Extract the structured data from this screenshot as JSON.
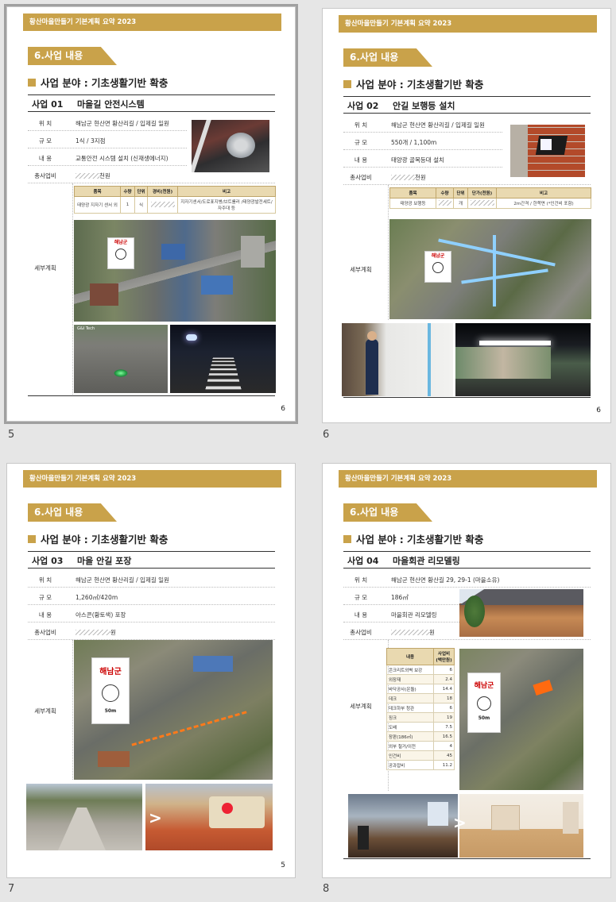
{
  "header_text": "황산마을만들기 기본계획 요약  2023",
  "section_tag": "6.사업 내용",
  "field_title": "사업 분야 : 기초생활기반 확충",
  "labels": {
    "location": "위  치",
    "scale": "규  모",
    "content": "내  용",
    "budget": "총사업비",
    "detail": "세부계획"
  },
  "slides": [
    {
      "thumb_number": "5",
      "page_number": "6",
      "code": "사업 01",
      "title": "마을길 안전시스템",
      "location": "해남군 현산면 황산리길 / 입제길 일원",
      "scale": "1식 / 3지점",
      "content": "교통안전 시스템 설치 (신재생에너지)",
      "budget": "천원",
      "table": {
        "headers": [
          "품목",
          "수량",
          "단위",
          "경비(천원)",
          "비고"
        ],
        "row": [
          "태양광 지자기 센서 외",
          "1",
          "식",
          "",
          "지자기센서/도로표지병/브트롤러 /태양광발전세트/자주대 등"
        ]
      },
      "map_logo": "해남군",
      "photo_caption": "G&I Tech"
    },
    {
      "thumb_number": "6",
      "page_number": "6",
      "code": "사업 02",
      "title": "안길 보행등 설치",
      "location": "해남군 현산면 황산리길 / 입제길 일원",
      "scale": "550개 / 1,100m",
      "content": "태양광 골목등대 설치",
      "budget": "천원",
      "table": {
        "headers": [
          "품목",
          "수량",
          "단위",
          "단가(천원)",
          "비고"
        ],
        "row": [
          "태양광 보행등",
          "",
          "개",
          "",
          "2m간격 / 한쪽면 (*인건비 포함)"
        ]
      },
      "map_logo": "해남군"
    },
    {
      "thumb_number": "7",
      "page_number": "5",
      "code": "사업 03",
      "title": "마을 안길 포장",
      "location": "해남군 현산면 황산리길 / 입제길 일원",
      "scale": "1,260㎡/420m",
      "content": "아스콘(황토색) 포장",
      "budget": "원",
      "map_logo": "해남군",
      "map_scale": "50m"
    },
    {
      "thumb_number": "8",
      "page_number": "",
      "code": "사업 04",
      "title": "마을회관 리모델링",
      "location": "해남군 현산면 황산길 29, 29-1 (마을소유)",
      "scale": "186㎡",
      "content": "마을회관 리모델링",
      "budget": "원",
      "cost_headers": [
        "내용",
        "사업비 (백만원)"
      ],
      "cost_rows": [
        [
          "콘크리트외벽 보강",
          "6"
        ],
        [
          "외장재",
          "2.4"
        ],
        [
          "바닥공사(온돌)",
          "14.4"
        ],
        [
          "데크",
          "18"
        ],
        [
          "데크하부 청관",
          "6"
        ],
        [
          "징크",
          "19"
        ],
        [
          "도배",
          "7.5"
        ],
        [
          "장판(186㎡)",
          "16.5"
        ],
        [
          "외부 철거/이전",
          "4"
        ],
        [
          "인건비",
          "45"
        ],
        [
          "공과잡비",
          "11.2"
        ]
      ],
      "map_logo": "해남군",
      "map_scale": "50m"
    }
  ],
  "colors": {
    "accent": "#c9a24a",
    "canvas": "#e6e6e6"
  }
}
